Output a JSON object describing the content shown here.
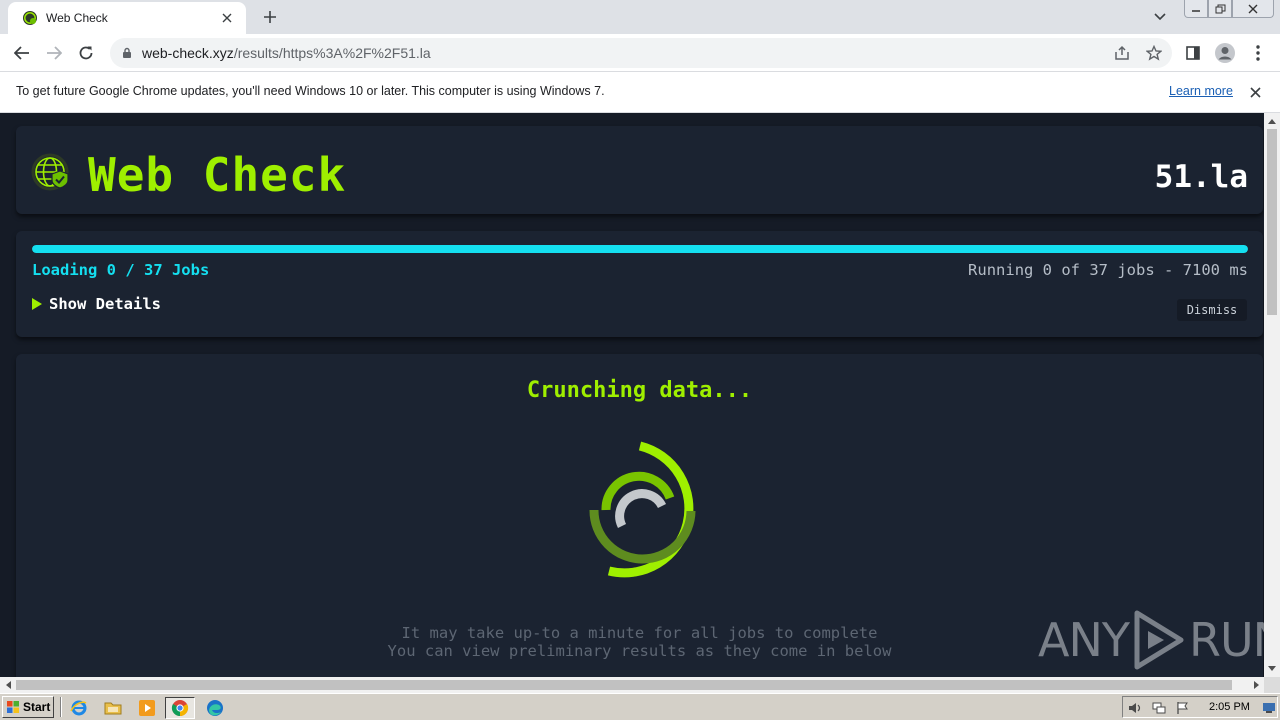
{
  "browser": {
    "tab_title": "Web Check",
    "url_host": "web-check.xyz",
    "url_path": "/results/https%3A%2F%2F51.la"
  },
  "infobar": {
    "message": "To get future Google Chrome updates, you'll need Windows 10 or later. This computer is using Windows 7.",
    "link": "Learn more"
  },
  "header": {
    "brand": "Web Check",
    "site": "51.la"
  },
  "progress": {
    "loading_text": "Loading 0 / 37 Jobs",
    "running_text": "Running 0 of 37 jobs - 7100 ms",
    "details_label": "Show Details",
    "dismiss_label": "Dismiss",
    "fill_fraction": 1.0
  },
  "loader": {
    "title": "Crunching data...",
    "hint_line1": "It may take up-to a minute for all jobs to complete",
    "hint_line2": "You can view preliminary results as they come in below"
  },
  "watermark": {
    "left": "ANY",
    "right": "RUN"
  },
  "taskbar": {
    "start_label": "Start",
    "clock": "2:05 PM"
  },
  "colors": {
    "accent_green": "#9fef00",
    "accent_cyan": "#14dff0",
    "page_bg": "#151b26",
    "card_bg": "#1b2331"
  },
  "icons": {
    "tab": "web-check-favicon",
    "logo": "globe-shield-icon",
    "spinner": "loading-rings-icon"
  }
}
